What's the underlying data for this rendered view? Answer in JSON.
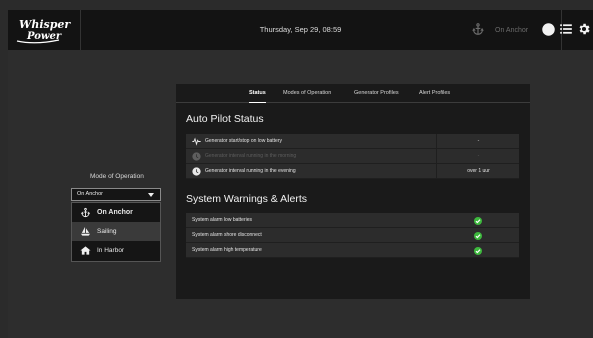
{
  "header": {
    "logo_text": "Whisper Power",
    "datetime": "Thursday, Sep 29, 08:59",
    "anchor_status": "On Anchor",
    "icons": [
      "anchor-icon",
      "contrast-icon",
      "list-icon",
      "gear-icon"
    ]
  },
  "sidebar": {
    "mode_label": "Mode of Operation",
    "selected": "On Anchor",
    "options": [
      "On Anchor",
      "Sailing",
      "In Harbor"
    ],
    "option_icons": [
      "anchor-icon",
      "sailboat-icon",
      "house-icon"
    ]
  },
  "tabs": [
    "Status",
    "Modes of Operation",
    "Generator Profiles",
    "Alert Profiles"
  ],
  "active_tab": "Status",
  "autopilot": {
    "title": "Auto Pilot Status",
    "rows": [
      {
        "label": "Generator start/stop on low battery",
        "value": "-",
        "icon": "waveform-icon",
        "dim": false
      },
      {
        "label": "Generator interval running in the morning",
        "value": "-",
        "icon": "clock-icon",
        "dim": true
      },
      {
        "label": "Generator interval running in the evening",
        "value": "over 1 uur",
        "icon": "clock-icon",
        "dim": false
      }
    ]
  },
  "warnings": {
    "title": "System Warnings & Alerts",
    "rows": [
      {
        "label": "System alarm low batteries",
        "status": "ok"
      },
      {
        "label": "System alarm shore disconnect",
        "status": "ok"
      },
      {
        "label": "System alarm high temperature",
        "status": "ok"
      }
    ]
  },
  "colors": {
    "ok": "#3db83d",
    "background": "#2d2d2d",
    "panel": "#1a1a1a",
    "topbar": "#131313"
  }
}
